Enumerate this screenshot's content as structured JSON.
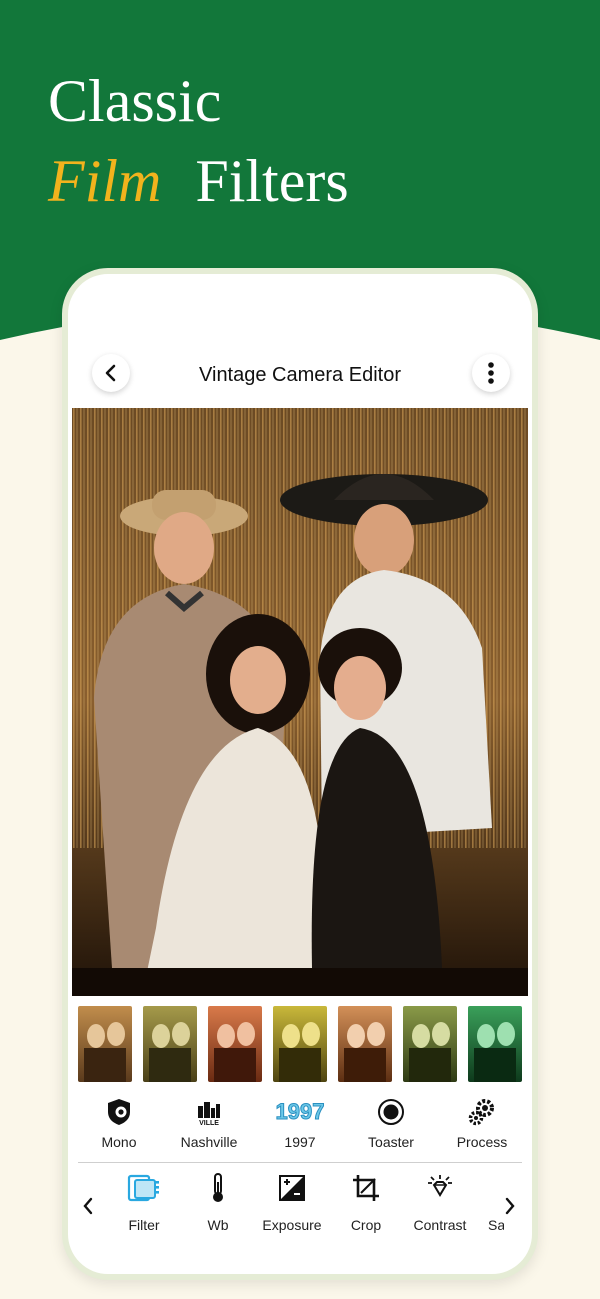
{
  "promo": {
    "line1": "Classic",
    "word_film": "Film",
    "word_filters": "Filters",
    "colors": {
      "green": "#12773a",
      "gold": "#f2b31d",
      "cream": "#fbf7ea"
    }
  },
  "app": {
    "title": "Vintage Camera Editor",
    "back_icon": "chevron-left-icon",
    "menu_icon": "more-vertical-icon"
  },
  "thumbnails": [
    "sepia",
    "olive",
    "red-tone",
    "yellow",
    "orange",
    "vintage-green",
    "green"
  ],
  "filters": [
    {
      "label": "Mono",
      "icon": "mono-shield-icon"
    },
    {
      "label": "Nashville",
      "icon": "nashville-city-icon"
    },
    {
      "label": "1997",
      "icon": "1997-text-icon",
      "icon_text": "1997"
    },
    {
      "label": "Toaster",
      "icon": "toaster-circle-icon"
    },
    {
      "label": "Process",
      "icon": "gears-icon"
    }
  ],
  "tools": [
    {
      "label": "Filter",
      "icon": "filter-film-icon",
      "active": true,
      "active_color": "#29a8e0"
    },
    {
      "label": "Wb",
      "icon": "thermometer-icon"
    },
    {
      "label": "Exposure",
      "icon": "exposure-icon"
    },
    {
      "label": "Crop",
      "icon": "crop-icon"
    },
    {
      "label": "Contrast",
      "icon": "diamond-sun-icon"
    },
    {
      "label": "Sa",
      "icon": "saturation-icon"
    }
  ]
}
